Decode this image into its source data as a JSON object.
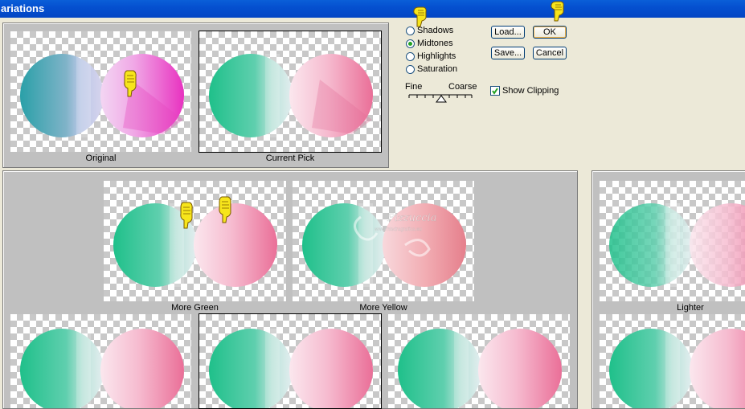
{
  "window": {
    "title": "ariations"
  },
  "previews": {
    "original_label": "Original",
    "current_pick_label": "Current Pick"
  },
  "tones": {
    "options": [
      "Shadows",
      "Midtones",
      "Highlights",
      "Saturation"
    ],
    "selected": "Midtones"
  },
  "slider": {
    "fine_label": "Fine",
    "coarse_label": "Coarse"
  },
  "buttons": {
    "load": "Load...",
    "ok": "OK",
    "save": "Save...",
    "cancel": "Cancel"
  },
  "show_clipping": {
    "label": "Show Clipping",
    "checked": true
  },
  "variations": {
    "more_green": "More Green",
    "more_yellow": "More Yellow",
    "lighter": "Lighter"
  },
  "watermark": {
    "text": "Pizzuccia",
    "url": "www.misdragrafica.eu"
  },
  "icons": [
    "pointing-hand-icon",
    "radio-icon",
    "checkbox-icon"
  ]
}
